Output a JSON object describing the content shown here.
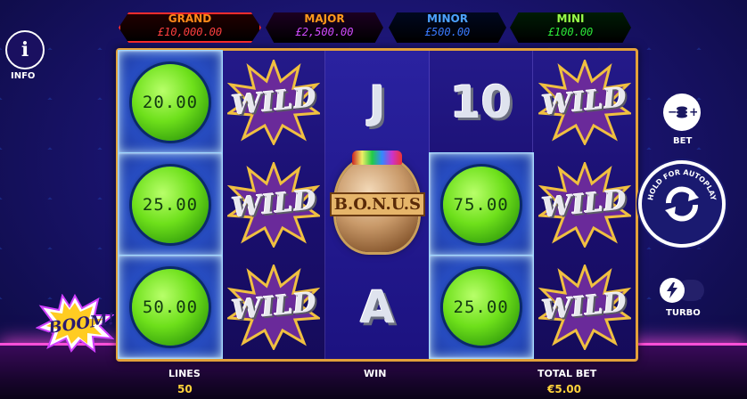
{
  "jackpots": [
    {
      "label": "GRAND",
      "value": "£10,000.00"
    },
    {
      "label": "MAJOR",
      "value": "£2,500.00"
    },
    {
      "label": "MINOR",
      "value": "£500.00"
    },
    {
      "label": "MINI",
      "value": "£100.00"
    }
  ],
  "side": {
    "info_label": "INFO",
    "bet_label": "BET",
    "autoplay_label": "HOLD FOR AUTOPLAY",
    "turbo_label": "TURBO",
    "boom_text": "BOOM!"
  },
  "reels": {
    "reel1": [
      "20.00",
      "25.00",
      "50.00"
    ],
    "reel2": [
      "WILD",
      "WILD",
      "WILD"
    ],
    "reel3": [
      "J",
      "B.O.N.U.S",
      "A"
    ],
    "reel4": [
      "10",
      "75.00",
      "25.00"
    ],
    "reel5": [
      "WILD",
      "WILD",
      "WILD"
    ]
  },
  "bottom": {
    "lines_label": "LINES",
    "lines_value": "50",
    "win_label": "WIN",
    "total_bet_label": "TOTAL BET",
    "total_bet_value": "€5.00"
  },
  "colors": {
    "reel_frame": "#e3a13a",
    "ball_green": "#6ee01b",
    "value_yellow": "#ffd33a"
  }
}
